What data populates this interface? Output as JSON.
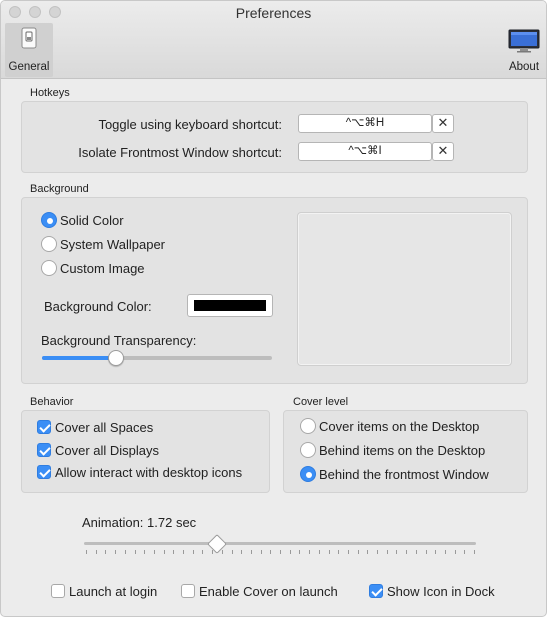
{
  "window": {
    "title": "Preferences"
  },
  "toolbar": {
    "items": [
      {
        "label": "General",
        "icon": "general-switch-icon"
      },
      {
        "label": "About",
        "icon": "monitor-icon"
      }
    ]
  },
  "hotkeys": {
    "section_title": "Hotkeys",
    "rows": [
      {
        "label": "Toggle using keyboard shortcut:",
        "shortcut": "^⌥⌘H",
        "clear": "✕"
      },
      {
        "label": "Isolate Frontmost Window shortcut:",
        "shortcut": "^⌥⌘I",
        "clear": "✕"
      }
    ]
  },
  "background": {
    "section_title": "Background",
    "options": [
      {
        "label": "Solid Color",
        "selected": true
      },
      {
        "label": "System Wallpaper",
        "selected": false
      },
      {
        "label": "Custom Image",
        "selected": false
      }
    ],
    "color_label": "Background Color:",
    "color_value": "#000000",
    "transparency_label": "Background Transparency:",
    "transparency_fraction": 0.32
  },
  "behavior": {
    "section_title": "Behavior",
    "options": [
      {
        "label": "Cover all Spaces",
        "checked": true
      },
      {
        "label": "Cover all Displays",
        "checked": true
      },
      {
        "label": "Allow interact with desktop icons",
        "checked": true
      }
    ]
  },
  "cover_level": {
    "section_title": "Cover level",
    "options": [
      {
        "label": "Cover items on the Desktop",
        "selected": false
      },
      {
        "label": "Behind items on the Desktop",
        "selected": false
      },
      {
        "label": "Behind the frontmost Window",
        "selected": true
      }
    ]
  },
  "animation": {
    "label": "Animation: 1.72 sec",
    "fraction": 0.34
  },
  "footer": {
    "options": [
      {
        "label": "Launch at login",
        "checked": false
      },
      {
        "label": "Enable Cover on launch",
        "checked": false
      },
      {
        "label": "Show Icon in Dock",
        "checked": true
      }
    ]
  },
  "colors": {
    "accent": "#3b8ef5"
  }
}
